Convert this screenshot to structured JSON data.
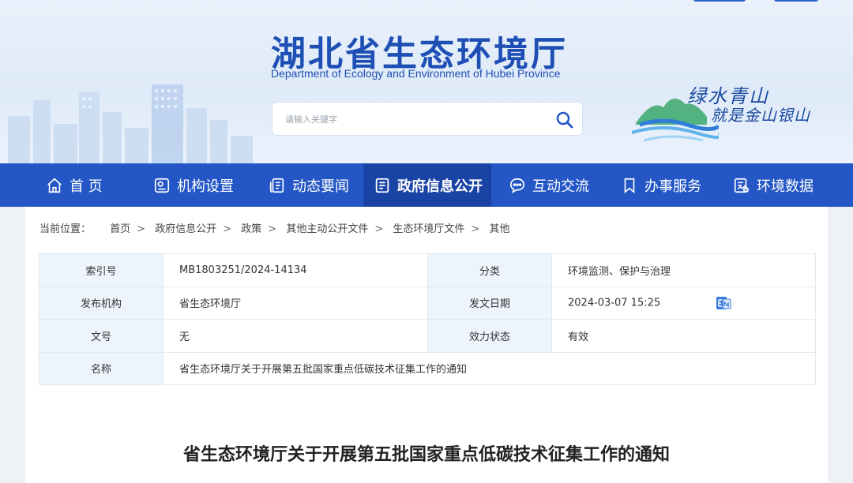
{
  "header": {
    "title": "湖北省生态环境厅",
    "subtitle": "Department of Ecology and Environment of Hubei Province",
    "search_placeholder": "请输入关键字",
    "slogan_line1": "绿水青山",
    "slogan_line2": "就是金山银山"
  },
  "nav": {
    "items": [
      {
        "label": "首 页",
        "icon": "home-icon"
      },
      {
        "label": "机构设置",
        "icon": "org-icon"
      },
      {
        "label": "动态要闻",
        "icon": "news-icon"
      },
      {
        "label": "政府信息公开",
        "icon": "doc-icon",
        "active": true
      },
      {
        "label": "互动交流",
        "icon": "chat-icon"
      },
      {
        "label": "办事服务",
        "icon": "bookmark-icon"
      },
      {
        "label": "环境数据",
        "icon": "data-icon"
      }
    ]
  },
  "breadcrumb": {
    "label": "当前位置：",
    "items": [
      "首页",
      "政府信息公开",
      "政策",
      "其他主动公开文件",
      "生态环境厅文件",
      "其他"
    ],
    "separator": ">"
  },
  "meta": {
    "index_label": "索引号",
    "index_value": "MB1803251/2024-14134",
    "category_label": "分类",
    "category_value": "环境监测、保护与治理",
    "issuer_label": "发布机构",
    "issuer_value": "省生态环境厅",
    "date_label": "发文日期",
    "date_value": "2024-03-07 15:25",
    "docno_label": "文号",
    "docno_value": "无",
    "status_label": "效力状态",
    "status_value": "有效",
    "name_label": "名称",
    "name_value": "省生态环境厅关于开展第五批国家重点低碳技术征集工作的通知"
  },
  "document": {
    "title": "省生态环境厅关于开展第五批国家重点低碳技术征集工作的通知"
  },
  "colors": {
    "brand": "#2457c5",
    "nav_active": "#1a43a6",
    "label_bg": "#eef4fb"
  }
}
